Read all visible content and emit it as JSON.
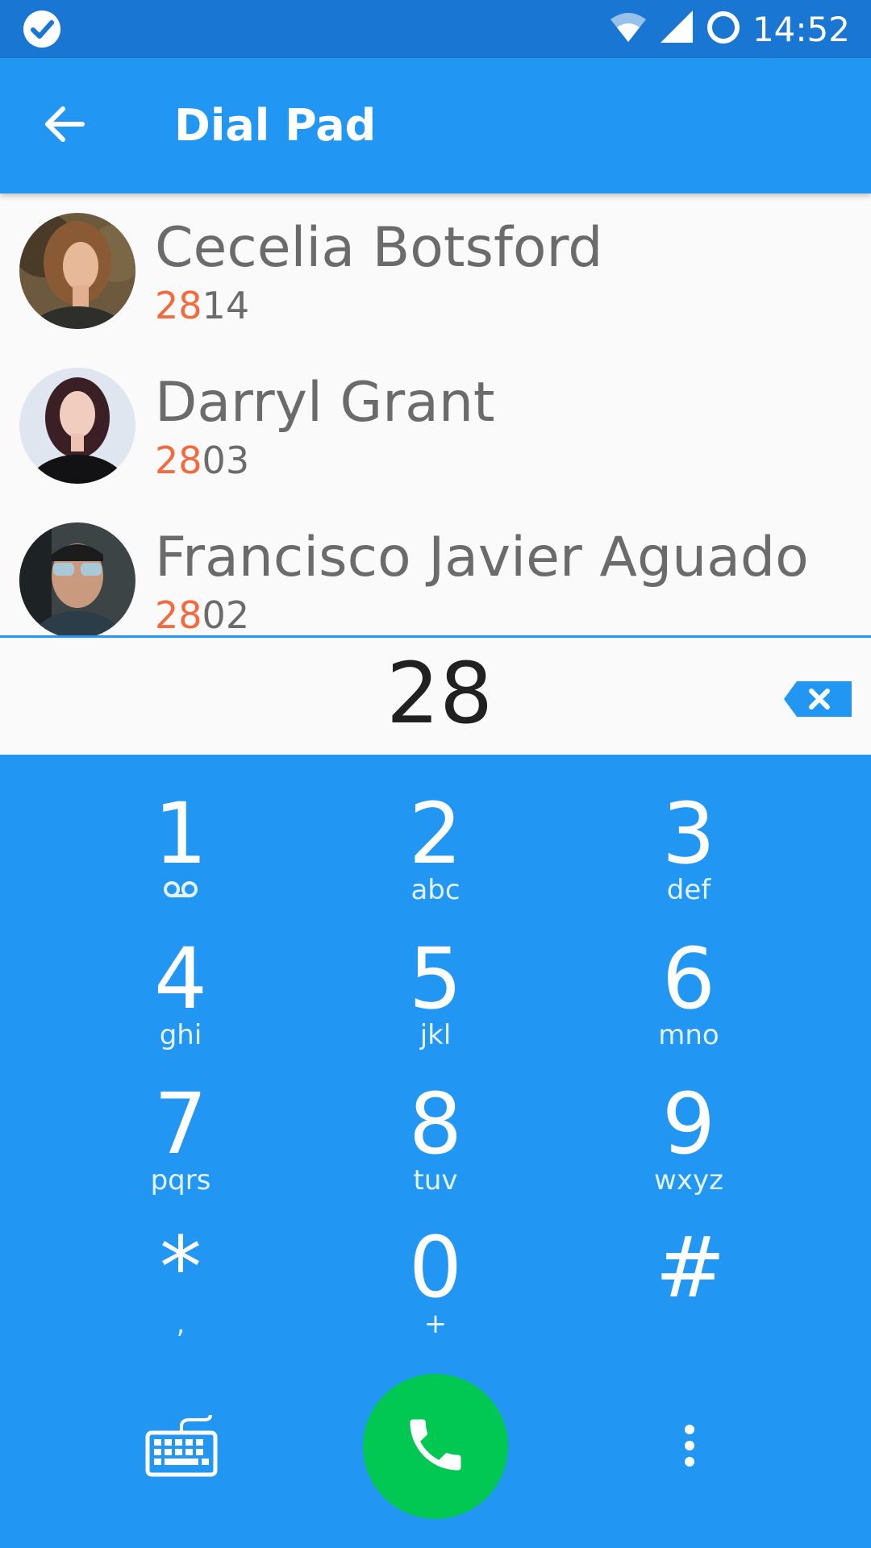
{
  "status_bar": {
    "time": "14:52",
    "icons": [
      "check-circle-icon",
      "wifi-icon",
      "cell-signal-icon",
      "ring-icon"
    ]
  },
  "app_bar": {
    "title": "Dial Pad",
    "back_icon": "arrow-back-icon"
  },
  "contacts": [
    {
      "name": "Cecelia Botsford",
      "number_match": "28",
      "number_rest": "14",
      "avatar": "avatar-photo"
    },
    {
      "name": "Darryl Grant",
      "number_match": "28",
      "number_rest": "03",
      "avatar": "avatar-photo"
    },
    {
      "name": "Francisco Javier Aguado",
      "number_match": "28",
      "number_rest": "02",
      "avatar": "avatar-photo"
    }
  ],
  "dialed": {
    "digits": "28",
    "backspace_icon": "backspace-icon"
  },
  "keys": [
    {
      "digit": "1",
      "letters": "",
      "sub_icon": "voicemail-icon"
    },
    {
      "digit": "2",
      "letters": "abc"
    },
    {
      "digit": "3",
      "letters": "def"
    },
    {
      "digit": "4",
      "letters": "ghi"
    },
    {
      "digit": "5",
      "letters": "jkl"
    },
    {
      "digit": "6",
      "letters": "mno"
    },
    {
      "digit": "7",
      "letters": "pqrs"
    },
    {
      "digit": "8",
      "letters": "tuv"
    },
    {
      "digit": "9",
      "letters": "wxyz"
    },
    {
      "digit": "*",
      "letters": ","
    },
    {
      "digit": "0",
      "letters": "+"
    },
    {
      "digit": "#",
      "letters": ""
    }
  ],
  "bottom_bar": {
    "keyboard_icon": "keyboard-icon",
    "call_icon": "phone-icon",
    "more_icon": "more-vert-icon"
  },
  "colors": {
    "status_bar": "#1976d2",
    "primary": "#2196f3",
    "call_green": "#00c853",
    "match_orange": "#f26a3d",
    "name_grey": "#6b6b6b"
  }
}
